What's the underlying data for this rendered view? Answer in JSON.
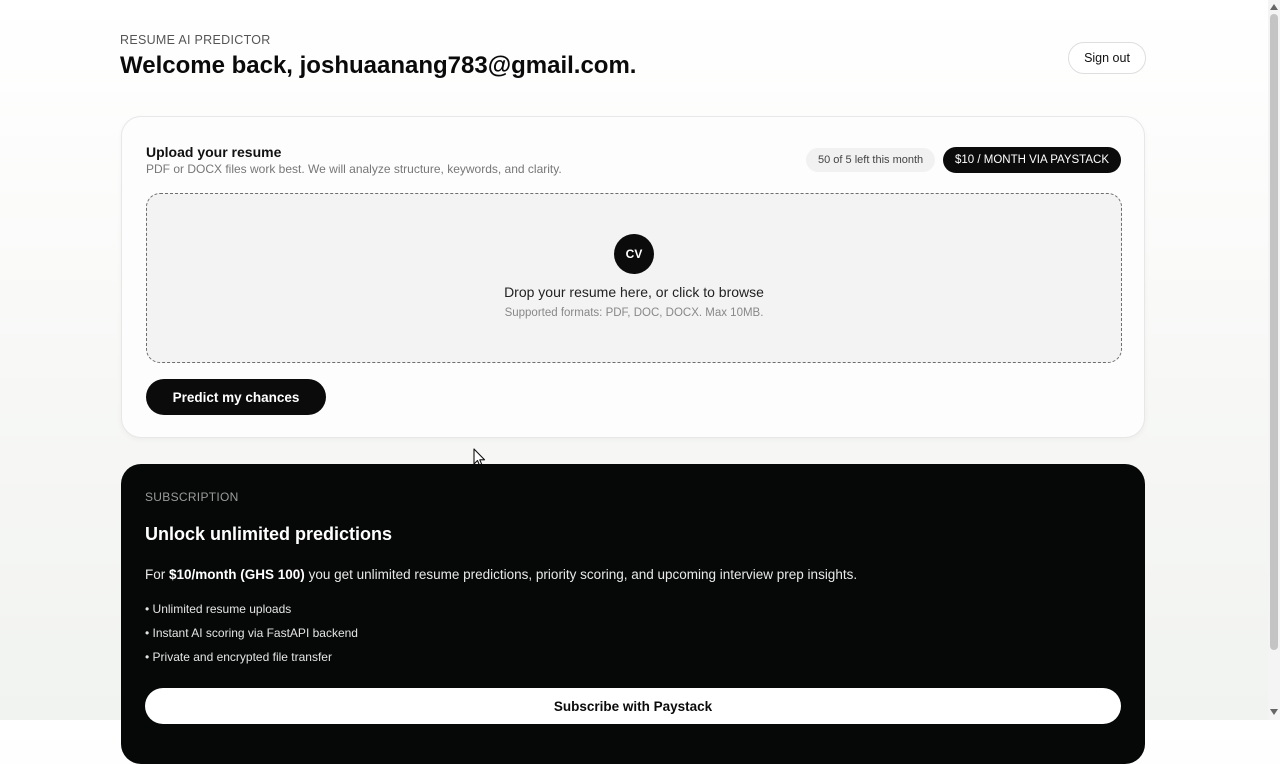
{
  "header": {
    "eyebrow": "RESUME AI PREDICTOR",
    "welcome": "Welcome back, joshuaanang783@gmail.com.",
    "sign_out": "Sign out"
  },
  "upload": {
    "title": "Upload your resume",
    "subtitle": "PDF or DOCX files work best. We will analyze structure, keywords, and clarity.",
    "quota": "50 of 5 left this month",
    "price_badge": "$10 / MONTH VIA PAYSTACK",
    "dropzone": {
      "icon_text": "CV",
      "main_text": "Drop your resume here, or click to browse",
      "formats": "Supported formats: PDF, DOC, DOCX. Max 10MB."
    },
    "predict_button": "Predict my chances"
  },
  "subscription": {
    "eyebrow": "SUBSCRIPTION",
    "title": "Unlock unlimited predictions",
    "desc_prefix": "For ",
    "desc_price": "$10/month (GHS 100)",
    "desc_suffix": " you get unlimited resume predictions, priority scoring, and upcoming interview prep insights.",
    "benefits": [
      "• Unlimited resume uploads",
      "• Instant AI scoring via FastAPI backend",
      "• Private and encrypted file transfer"
    ],
    "subscribe_button": "Subscribe with Paystack"
  },
  "colors": {
    "accent": "#0b0b0b",
    "card_bg": "#fdfdfd",
    "dark_card_bg": "#060808"
  }
}
